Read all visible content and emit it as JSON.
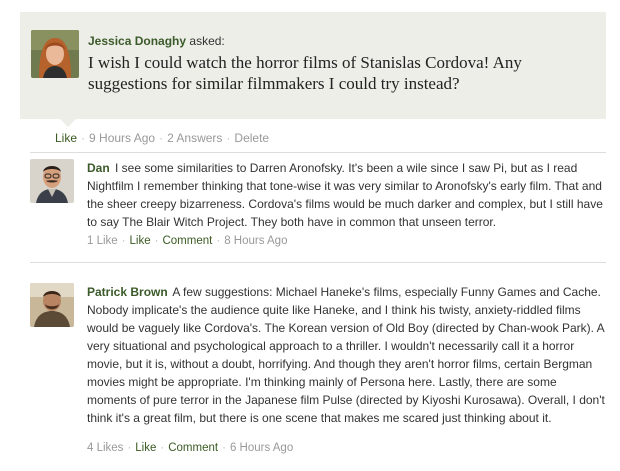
{
  "question": {
    "author": "Jessica Donaghy",
    "verb": "asked:",
    "text": "I wish I could watch the horror films of Stanislas Cordova! Any suggestions for similar filmmakers I could try instead?",
    "meta": {
      "like": "Like",
      "time": "9 Hours Ago",
      "answers": "2 Answers",
      "delete": "Delete"
    }
  },
  "answers": [
    {
      "author": "Dan",
      "text": "I see some similarities to Darren Aronofsky. It's been a wile since I saw Pi, but as I read Nightfilm I remember thinking that tone-wise it was very similar to Aronofsky's early film. That and the sheer creepy bizarreness. Cordova's films would be much darker and complex, but I still have to say The Blair Witch Project. They both have in common that unseen terror.",
      "likes": "1 Like",
      "like": "Like",
      "comment": "Comment",
      "time": "8 Hours Ago"
    },
    {
      "author": "Patrick Brown",
      "text": "A few suggestions: Michael Haneke's films, especially Funny Games and Cache. Nobody implicate's the audience quite like Haneke, and I think his twisty, anxiety-riddled films would be vaguely like Cordova's. The Korean version of Old Boy (directed by Chan-wook Park). A very situational and psychological approach to a thriller. I wouldn't necessarily call it a horror movie, but it is, without a doubt, horrifying. And though they aren't horror films, certain Bergman movies might be appropriate. I'm thinking mainly of Persona here. Lastly, there are some moments of pure terror in the Japanese film Pulse (directed by Kiyoshi Kurosawa). Overall, I don't think it's a great film, but there is one scene that makes me scared just thinking about it.",
      "likes": "4 Likes",
      "like": "Like",
      "comment": "Comment",
      "time": "6 Hours Ago"
    }
  ],
  "colors": {
    "author_link": "#3b5a2a",
    "question_bg": "#eeeee8",
    "meta_gray": "#999999"
  }
}
